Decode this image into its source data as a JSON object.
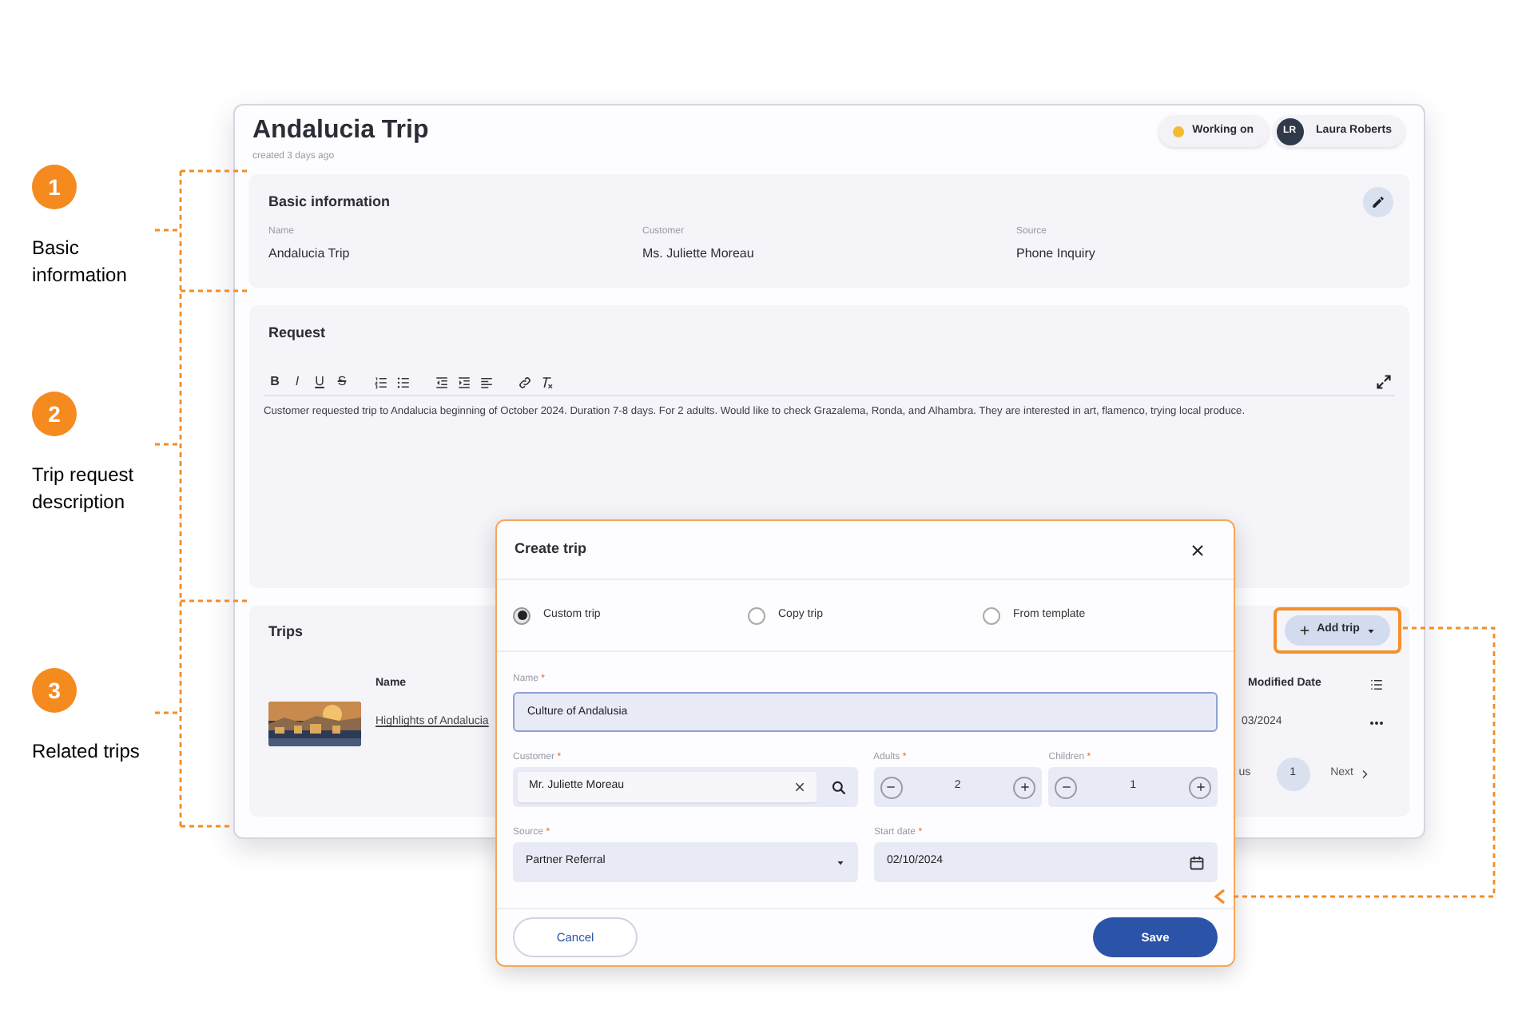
{
  "annotations": [
    {
      "number": "1",
      "label": "Basic information"
    },
    {
      "number": "2",
      "label": "Trip request description"
    },
    {
      "number": "3",
      "label": "Related trips"
    }
  ],
  "page": {
    "title": "Andalucia Trip",
    "subtitle": "created 3 days ago",
    "status": {
      "label": "Working on",
      "color": "#f2bb33"
    },
    "user": {
      "initials": "LR",
      "name": "Laura Roberts"
    }
  },
  "basic_information": {
    "title": "Basic information",
    "fields": [
      {
        "label": "Name",
        "value": "Andalucia Trip"
      },
      {
        "label": "Customer",
        "value": "Ms. Juliette Moreau"
      },
      {
        "label": "Source",
        "value": "Phone Inquiry"
      }
    ]
  },
  "request": {
    "title": "Request",
    "toolbar": [
      {
        "kind": "bold",
        "glyph": "B"
      },
      {
        "kind": "italic",
        "glyph": "I"
      },
      {
        "kind": "underline",
        "glyph": "U"
      },
      {
        "kind": "strike",
        "glyph": "S"
      },
      {
        "kind": "ordered-list"
      },
      {
        "kind": "bullet-list"
      },
      {
        "kind": "outdent"
      },
      {
        "kind": "indent"
      },
      {
        "kind": "align"
      },
      {
        "kind": "link"
      },
      {
        "kind": "clear-format"
      }
    ],
    "text": "Customer requested trip to Andalucia beginning of October 2024. Duration 7-8 days. For 2 adults. Would like to check Grazalema, Ronda, and Alhambra. They are interested in art, flamenco, trying local produce."
  },
  "trips": {
    "title": "Trips",
    "add_button": "Add trip",
    "columns": [
      "Name",
      "Modified Date"
    ],
    "rows": [
      {
        "name": "Highlights of Andalucia",
        "modified": "03/2024"
      }
    ],
    "pagination": {
      "previous": "us",
      "page": "1",
      "next": "Next"
    }
  },
  "dialog": {
    "title": "Create trip",
    "options": [
      {
        "label": "Custom trip",
        "selected": true
      },
      {
        "label": "Copy trip",
        "selected": false
      },
      {
        "label": "From template",
        "selected": false
      }
    ],
    "name": {
      "label": "Name",
      "required_mark": "*",
      "value": "Culture of Andalusia"
    },
    "customer": {
      "label": "Customer",
      "required_mark": "*",
      "value": "Mr. Juliette Moreau"
    },
    "adults": {
      "label": "Adults",
      "required_mark": "*",
      "value": "2"
    },
    "children": {
      "label": "Children",
      "required_mark": "*",
      "value": "1"
    },
    "source": {
      "label": "Source",
      "required_mark": "*",
      "value": "Partner Referral"
    },
    "start_date": {
      "label": "Start date",
      "required_mark": "*",
      "value": "02/10/2024"
    },
    "cancel": "Cancel",
    "save": "Save"
  }
}
